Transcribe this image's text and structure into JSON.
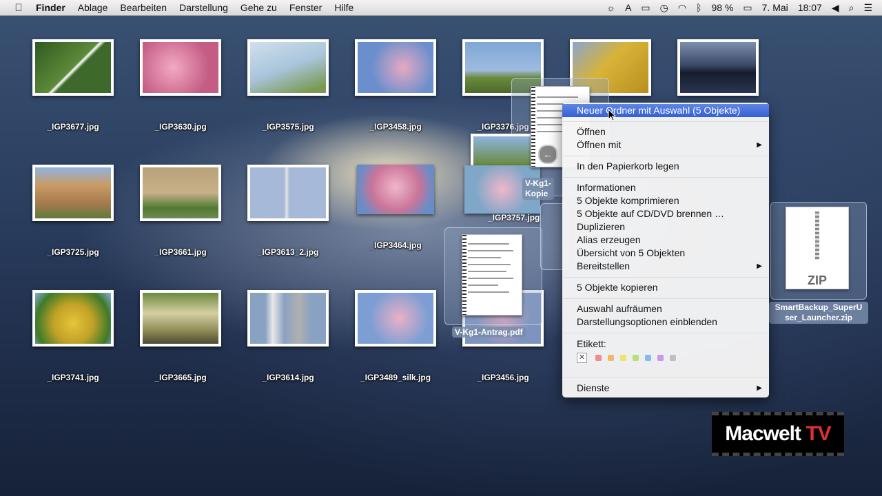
{
  "menubar": {
    "app": "Finder",
    "items": [
      "Ablage",
      "Bearbeiten",
      "Darstellung",
      "Gehe zu",
      "Fenster",
      "Hilfe"
    ],
    "battery": "98 %",
    "date": "7. Mai",
    "time": "18:07"
  },
  "icons": [
    {
      "label": "_IGP3677.jpg",
      "color": "#3d6a2a"
    },
    {
      "label": "_IGP3630.jpg",
      "color": "#d67a9c"
    },
    {
      "label": "_IGP3575.jpg",
      "color": "#a9c4da"
    },
    {
      "label": "_IGP3458.jpg",
      "color": "#6b8fcc"
    },
    {
      "label": "_IGP3376.jpg",
      "color": "#7fa6d6"
    },
    {
      "label": "_IGP3725.jpg",
      "color": "#a77a4f"
    },
    {
      "label": "_IGP3661.jpg",
      "color": "#6f8a52"
    },
    {
      "label": "_IGP3613_2.jpg",
      "color": "#a7b9d8"
    },
    {
      "label": "_IGP3464.jpg",
      "color": "#c97598"
    },
    {
      "label": "_IGP3757.jpg",
      "color": "#7fa7c8"
    },
    {
      "label": "_IGP3741.jpg",
      "color": "#c2a227"
    },
    {
      "label": "_IGP3665.jpg",
      "color": "#8d8a55"
    },
    {
      "label": "_IGP3614.jpg",
      "color": "#8aa2c2"
    },
    {
      "label": "_IGP3489_silk.jpg",
      "color": "#7d9ed4"
    },
    {
      "label": "_IGP3456.jpg",
      "color": "#7f93c0"
    }
  ],
  "extra_thumbs": {
    "building": "#d8b337",
    "lake": "#3a4a66"
  },
  "selected": {
    "label_top": "V-Kg1-",
    "label_top2": "Kopie",
    "label_pdf": "V-Kg1-Antrag.pdf"
  },
  "zip": {
    "badge": "ZIP",
    "label_line1": "SmartBackup_SuperU",
    "label_line2": "ser_Launcher.zip"
  },
  "context_menu": {
    "items": {
      "new_folder": "Neuer Ordner mit Auswahl (5 Objekte)",
      "open": "Öffnen",
      "open_with": "Öffnen mit",
      "trash": "In den Papierkorb legen",
      "info": "Informationen",
      "compress": "5 Objekte komprimieren",
      "burn": "5 Objekte auf CD/DVD brennen …",
      "duplicate": "Duplizieren",
      "alias": "Alias erzeugen",
      "overview": "Übersicht von 5 Objekten",
      "share": "Bereitstellen",
      "copy": "5 Objekte kopieren",
      "cleanup": "Auswahl aufräumen",
      "view_options": "Darstellungsoptionen einblenden",
      "label_heading": "Etikett:",
      "services": "Dienste"
    },
    "label_colors": [
      "#f28b8b",
      "#f5b86b",
      "#f2e46a",
      "#b8e07a",
      "#8ab8f0",
      "#c79ae6",
      "#bfbfbf"
    ]
  },
  "logo": {
    "text": "Macwelt",
    "tv": "TV"
  }
}
